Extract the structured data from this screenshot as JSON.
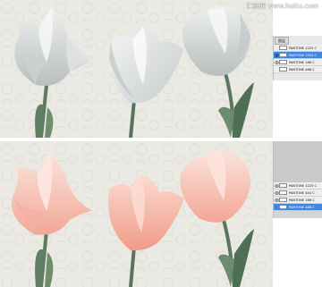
{
  "watermark": "汇图网 www.huitu.com",
  "top_panel": {
    "layers_tab_label": "图层",
    "layers": [
      {
        "name": "PANTONE 1225 C",
        "visible": false,
        "selected": false
      },
      {
        "name": "PANTONE 1505 C",
        "visible": true,
        "selected": true
      },
      {
        "name": "PANTONE 186 C",
        "visible": true,
        "selected": false
      },
      {
        "name": "PANTONE 466 C",
        "visible": false,
        "selected": false
      }
    ]
  },
  "bottom_panel": {
    "layers": [
      {
        "name": "PANTONE 1225 C",
        "visible": true,
        "selected": false
      },
      {
        "name": "PANTONE 444 C",
        "visible": true,
        "selected": false
      },
      {
        "name": "PANTONE 186 C",
        "visible": true,
        "selected": false
      },
      {
        "name": "PANTONE 466 C",
        "visible": false,
        "selected": true
      }
    ]
  },
  "colors": {
    "background_paper": "#ebe9e3",
    "tulip_grey": "#d3d6d6",
    "tulip_pink": "#f3b5a7",
    "stem_green": "#5e7b62",
    "selection_blue": "#3f86e0"
  }
}
